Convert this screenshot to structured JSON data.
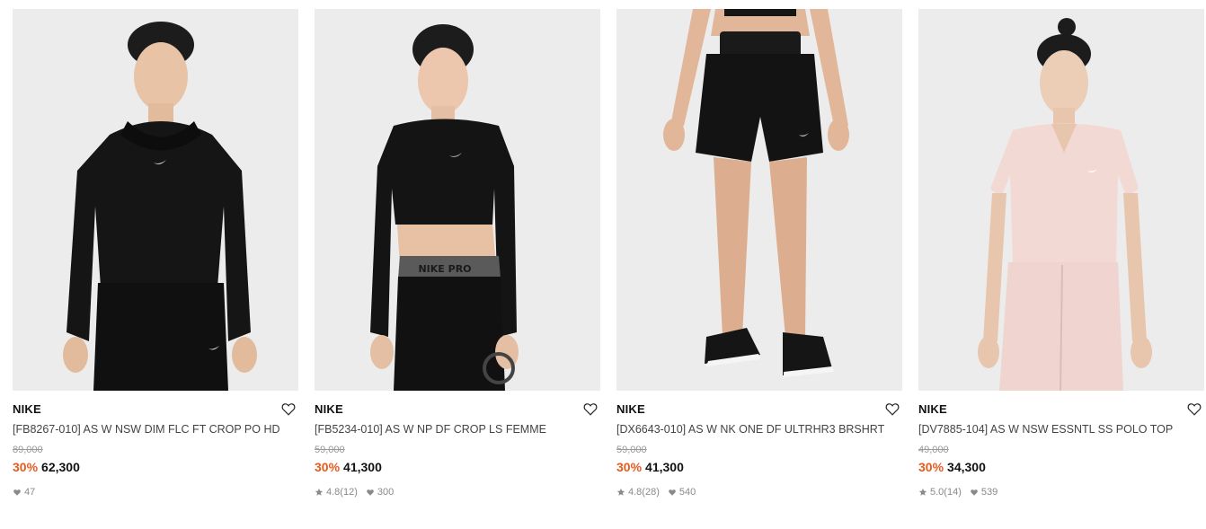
{
  "products": [
    {
      "brand": "NIKE",
      "name": "[FB8267-010] AS W NSW DIM FLC FT CROP PO HD",
      "original_price": "89,000",
      "discount": "30%",
      "sale_price": "62,300",
      "rating": null,
      "rating_count": null,
      "likes": "47",
      "image": "model-black-cropped-hoodie"
    },
    {
      "brand": "NIKE",
      "name": "[FB5234-010] AS W NP DF CROP LS FEMME",
      "original_price": "59,000",
      "discount": "30%",
      "sale_price": "41,300",
      "rating": "4.8",
      "rating_count": "(12)",
      "likes": "300",
      "image": "model-black-crop-long-sleeve"
    },
    {
      "brand": "NIKE",
      "name": "[DX6643-010] AS W NK ONE DF ULTRHR3 BRSHRT",
      "original_price": "59,000",
      "discount": "30%",
      "sale_price": "41,300",
      "rating": "4.8",
      "rating_count": "(28)",
      "likes": "540",
      "image": "model-black-shorts"
    },
    {
      "brand": "NIKE",
      "name": "[DV7885-104] AS W NSW ESSNTL SS POLO TOP",
      "original_price": "49,000",
      "discount": "30%",
      "sale_price": "34,300",
      "rating": "5.0",
      "rating_count": "(14)",
      "likes": "539",
      "image": "model-pink-polo"
    }
  ],
  "colors": {
    "discount": "#e85a1a",
    "image_bg": "#ececec",
    "muted": "#8a8a8a"
  }
}
